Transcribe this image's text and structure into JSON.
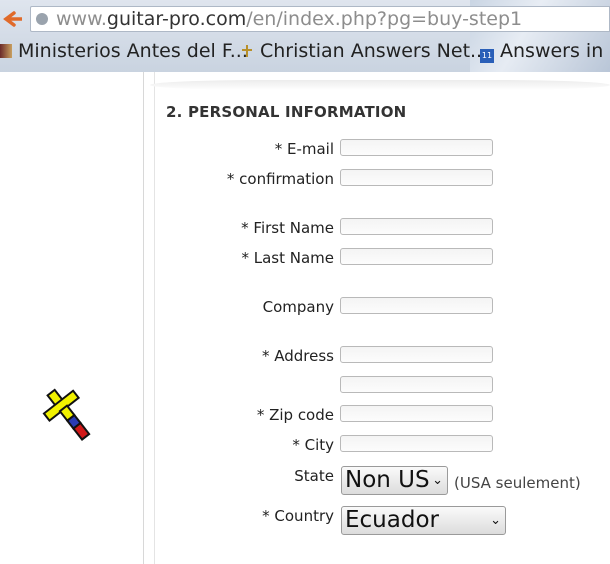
{
  "browser": {
    "address_scheme_prefix": "www.",
    "address_domain": "guitar-pro.com",
    "address_path": "/en/index.php?pg=buy-step1",
    "bookmarks": [
      {
        "label": "Ministerios Antes del F...",
        "icon": "flag-favicon"
      },
      {
        "label": "Christian Answers Net...",
        "icon": "cross-favicon"
      },
      {
        "label": "Answers in G",
        "icon": "calendar-favicon"
      }
    ]
  },
  "form": {
    "section_title": "2. PERSONAL INFORMATION",
    "fields": {
      "email": {
        "label": "* E-mail",
        "value": ""
      },
      "confirmation": {
        "label": "* confirmation",
        "value": ""
      },
      "first_name": {
        "label": "* First Name",
        "value": ""
      },
      "last_name": {
        "label": "* Last Name",
        "value": ""
      },
      "company": {
        "label": "Company",
        "value": ""
      },
      "address": {
        "label": "* Address",
        "value": "",
        "value2": ""
      },
      "zip": {
        "label": "* Zip code",
        "value": ""
      },
      "city": {
        "label": "* City",
        "value": ""
      },
      "state": {
        "label": "State",
        "value": "Non US",
        "note": "(USA seulement)"
      },
      "country": {
        "label": "* Country",
        "value": "Ecuador"
      }
    }
  },
  "colors": {
    "accent_yellow": "#f2f200",
    "flag_blue": "#2a3bb5",
    "flag_red": "#d01818"
  }
}
